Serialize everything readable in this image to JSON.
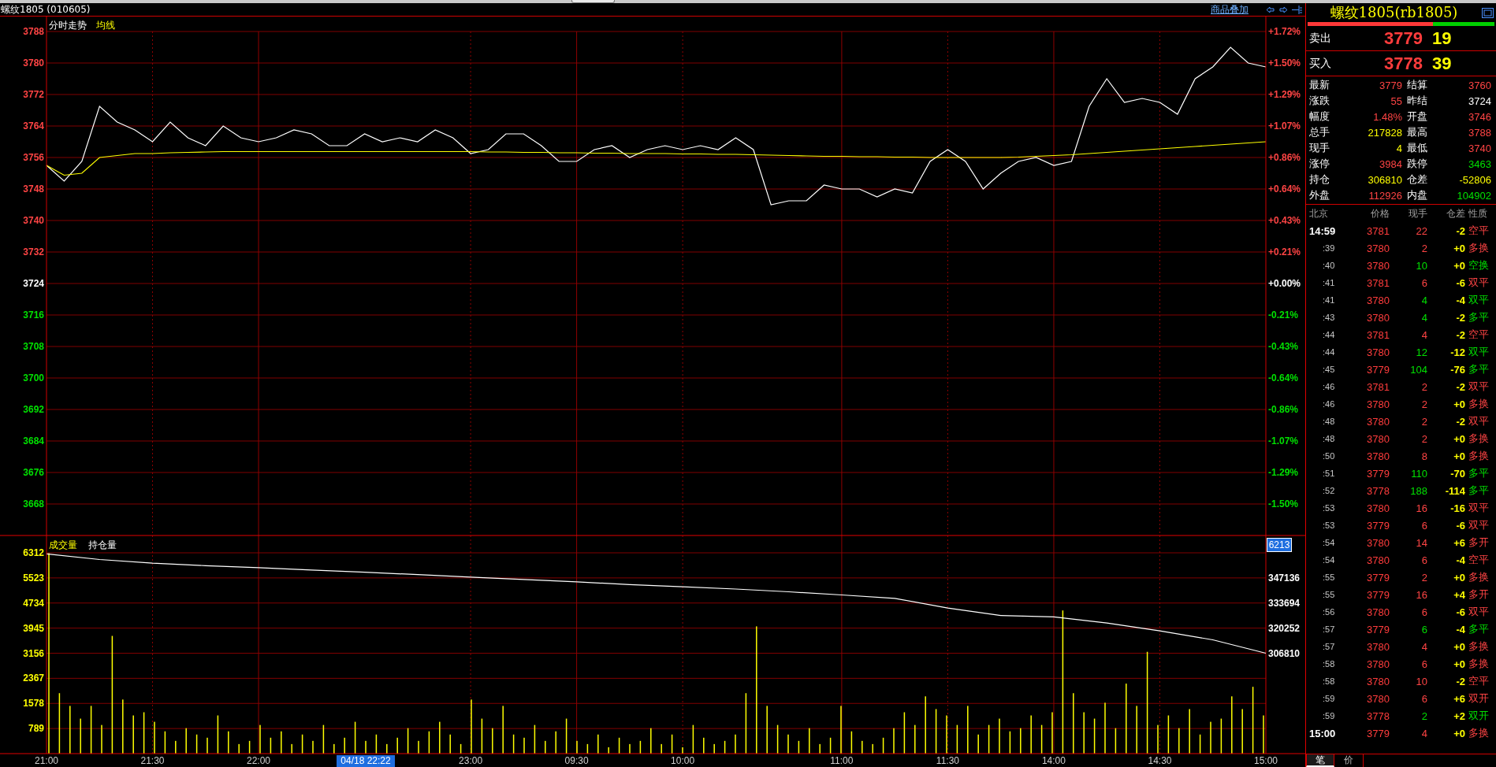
{
  "title_bar": {
    "title": "螺纹1805 (010605)",
    "overlay_link": "商品叠加"
  },
  "price_panel": {
    "chart_data": {
      "type": "line",
      "grid": true,
      "ylim": [
        3660,
        3788
      ],
      "yticks": [
        3788,
        3780,
        3772,
        3764,
        3756,
        3748,
        3740,
        3732,
        3724,
        3716,
        3708,
        3700,
        3692,
        3684,
        3676,
        3668
      ],
      "categories": [
        null,
        null,
        null,
        null,
        null,
        null,
        null,
        null,
        null,
        null,
        null,
        null,
        null,
        null,
        null,
        null,
        null,
        null,
        null,
        null,
        null,
        null,
        null,
        null,
        null,
        null,
        null,
        null,
        null,
        null,
        null,
        null,
        null,
        null,
        null,
        null,
        null,
        null,
        null,
        null,
        null,
        null,
        null,
        null,
        null,
        null,
        null,
        null,
        null,
        null,
        null,
        null,
        null,
        null,
        null,
        null,
        null,
        null,
        null,
        null,
        null,
        null,
        null,
        null,
        null,
        null,
        null,
        null,
        null,
        null
      ],
      "series": [
        {
          "name": "分时走势",
          "color": "#ffffff",
          "values": [
            3754,
            3750,
            3755,
            3769,
            3765,
            3763,
            3760,
            3765,
            3761,
            3759,
            3764,
            3761,
            3760,
            3761,
            3763,
            3762,
            3759,
            3759,
            3762,
            3760,
            3761,
            3760,
            3763,
            3761,
            3757,
            3758,
            3762,
            3762,
            3759,
            3755,
            3755,
            3758,
            3759,
            3756,
            3758,
            3759,
            3758,
            3759,
            3758,
            3761,
            3758,
            3744,
            3745,
            3745,
            3749,
            3748,
            3748,
            3746,
            3748,
            3747,
            3755,
            3758,
            3755,
            3748,
            3752,
            3755,
            3756,
            3754,
            3755,
            3769,
            3776,
            3770,
            3771,
            3770,
            3767,
            3776,
            3779,
            3784,
            3780,
            3779
          ]
        },
        {
          "name": "均线",
          "color": "#ffff00",
          "values": [
            3754,
            3751.5,
            3752,
            3756,
            3756.5,
            3757,
            3757,
            3757.2,
            3757.3,
            3757.4,
            3757.5,
            3757.5,
            3757.5,
            3757.5,
            3757.5,
            3757.5,
            3757.5,
            3757.5,
            3757.5,
            3757.5,
            3757.5,
            3757.5,
            3757.5,
            3757.5,
            3757.5,
            3757.4,
            3757.4,
            3757.3,
            3757.3,
            3757.2,
            3757.2,
            3757.1,
            3757.1,
            3757,
            3757,
            3757,
            3756.9,
            3756.9,
            3756.8,
            3756.8,
            3756.7,
            3756.6,
            3756.5,
            3756.4,
            3756.3,
            3756.3,
            3756.2,
            3756.2,
            3756.1,
            3756.1,
            3756,
            3756,
            3756,
            3756,
            3756,
            3756.1,
            3756.3,
            3756.5,
            3756.7,
            3757,
            3757.3,
            3757.6,
            3757.9,
            3758.2,
            3758.5,
            3758.8,
            3759.1,
            3759.4,
            3759.7,
            3760
          ]
        }
      ]
    },
    "percent_axis": [
      {
        "label": "+1.72%",
        "color": "#ff4444"
      },
      {
        "label": "+1.50%",
        "color": "#ff4444"
      },
      {
        "label": "+1.29%",
        "color": "#ff4444"
      },
      {
        "label": "+1.07%",
        "color": "#ff4444"
      },
      {
        "label": "+0.86%",
        "color": "#ff4444"
      },
      {
        "label": "+0.64%",
        "color": "#ff4444"
      },
      {
        "label": "+0.43%",
        "color": "#ff4444"
      },
      {
        "label": "+0.21%",
        "color": "#ff4444"
      },
      {
        "label": "+0.00%",
        "color": "#ffffff"
      },
      {
        "label": "-0.21%",
        "color": "#00e000"
      },
      {
        "label": "-0.43%",
        "color": "#00e000"
      },
      {
        "label": "-0.64%",
        "color": "#00e000"
      },
      {
        "label": "-0.86%",
        "color": "#00e000"
      },
      {
        "label": "-1.07%",
        "color": "#00e000"
      },
      {
        "label": "-1.29%",
        "color": "#00e000"
      },
      {
        "label": "-1.50%",
        "color": "#00e000"
      }
    ]
  },
  "volume_panel": {
    "chart_data": {
      "type": "bar",
      "grid": true,
      "ylim": [
        0,
        6312
      ],
      "yticks": [
        6312,
        5523,
        4734,
        3945,
        3156,
        2367,
        1578,
        789
      ],
      "categories": [
        "21:00",
        null,
        null,
        null,
        null,
        null,
        null,
        null,
        null,
        null,
        "21:30",
        null,
        null,
        null,
        null,
        null,
        null,
        null,
        null,
        null,
        "22:00",
        null,
        null,
        null,
        null,
        null,
        null,
        null,
        null,
        null,
        null,
        null,
        null,
        null,
        null,
        null,
        null,
        null,
        null,
        null,
        "23:00",
        null,
        null,
        null,
        null,
        null,
        null,
        null,
        null,
        null,
        "09:30",
        null,
        null,
        null,
        null,
        null,
        null,
        null,
        null,
        null,
        "10:00",
        null,
        null,
        null,
        null,
        null,
        null,
        null,
        null,
        null,
        null,
        null,
        null,
        null,
        null,
        "11:00",
        null,
        null,
        null,
        null,
        null,
        null,
        null,
        null,
        null,
        "11:30",
        null,
        null,
        null,
        null,
        null,
        null,
        null,
        null,
        null,
        "14:00",
        null,
        null,
        null,
        null,
        null,
        null,
        null,
        null,
        null,
        "14:30",
        null,
        null,
        null,
        null,
        null,
        null,
        null,
        null,
        null,
        "15:00"
      ],
      "series": [
        {
          "name": "成交量",
          "color": "#ffff00",
          "values": [
            6300,
            1900,
            1500,
            1100,
            1500,
            900,
            3700,
            1700,
            1200,
            1300,
            1000,
            700,
            400,
            800,
            600,
            500,
            1200,
            700,
            300,
            400,
            900,
            500,
            700,
            300,
            600,
            400,
            900,
            300,
            500,
            1000,
            400,
            600,
            300,
            500,
            800,
            400,
            700,
            1000,
            600,
            300,
            1700,
            1100,
            800,
            1500,
            600,
            500,
            900,
            400,
            700,
            1100,
            400,
            300,
            600,
            200,
            500,
            300,
            400,
            800,
            300,
            600,
            200,
            900,
            500,
            300,
            400,
            600,
            1900,
            4000,
            1500,
            900,
            600,
            400,
            800,
            300,
            500,
            1500,
            700,
            400,
            300,
            500,
            800,
            1300,
            900,
            1800,
            1400,
            1200,
            900,
            1500,
            600,
            900,
            1100,
            700,
            800,
            1200,
            900,
            1300,
            4500,
            1900,
            1300,
            1100,
            1600,
            800,
            2200,
            1500,
            3200,
            900,
            1200,
            800,
            1400,
            600,
            1000,
            1100,
            1800,
            1400,
            2100,
            1200
          ]
        }
      ]
    },
    "open_interest": {
      "chart_data": {
        "type": "line",
        "ylim": [
          253042,
          360578
        ],
        "yticks": [
          347136,
          333694,
          320252,
          306810
        ],
        "categories": [
          null,
          null,
          null,
          null,
          null,
          null,
          null,
          null,
          null,
          null,
          null,
          null,
          null,
          null,
          null,
          null,
          null,
          null,
          null,
          null,
          null,
          null,
          null,
          null
        ],
        "series": [
          {
            "name": "持仓量",
            "color": "#ffffff",
            "values": [
              360000,
              357000,
              355000,
              353700,
              352600,
              351400,
              350200,
              348900,
              347600,
              346300,
              345000,
              343600,
              342400,
              341200,
              339700,
              338000,
              336200,
              331000,
              327000,
              326300,
              323000,
              318800,
              314000,
              306810
            ]
          }
        ]
      }
    }
  },
  "cursor": {
    "time_label": "04/18 22:22",
    "volume_label": "6213"
  },
  "quote": {
    "title": "螺纹1805(rb1805)",
    "ratio_bar": {
      "level": 0.67
    },
    "ask": {
      "label": "卖出",
      "price": "3779",
      "volume": "19"
    },
    "bid": {
      "label": "买入",
      "price": "3778",
      "volume": "39"
    },
    "stats": [
      {
        "label": "最新",
        "value": "3779",
        "color": "#ff4444"
      },
      {
        "label": "结算",
        "value": "3760",
        "color": "#ff4444"
      },
      {
        "label": "涨跌",
        "value": "55",
        "color": "#ff4444"
      },
      {
        "label": "昨结",
        "value": "3724",
        "color": "#ffffff"
      },
      {
        "label": "幅度",
        "value": "1.48%",
        "color": "#ff4444"
      },
      {
        "label": "开盘",
        "value": "3746",
        "color": "#ff4444"
      },
      {
        "label": "总手",
        "value": "217828",
        "color": "#ffff00"
      },
      {
        "label": "最高",
        "value": "3788",
        "color": "#ff4444"
      },
      {
        "label": "现手",
        "value": "4",
        "color": "#ffff00"
      },
      {
        "label": "最低",
        "value": "3740",
        "color": "#ff4444"
      },
      {
        "label": "涨停",
        "value": "3984",
        "color": "#ff4444"
      },
      {
        "label": "跌停",
        "value": "3463",
        "color": "#00e000"
      },
      {
        "label": "持仓",
        "value": "306810",
        "color": "#ffff00"
      },
      {
        "label": "仓差",
        "value": "-52806",
        "color": "#ffff00"
      },
      {
        "label": "外盘",
        "value": "112926",
        "color": "#ff4444"
      },
      {
        "label": "内盘",
        "value": "104902",
        "color": "#00e000"
      }
    ]
  },
  "ticks": {
    "columns": [
      "北京",
      "价格",
      "现手",
      "仓差",
      "性质"
    ],
    "rows": [
      {
        "kind": "minute",
        "time": "14:59",
        "price": "3781",
        "volume": "22",
        "oi_change": "-2",
        "nature": "空平",
        "color": "#ff4444"
      },
      {
        "kind": "tick",
        "time": ":39",
        "price": "3780",
        "volume": "2",
        "oi_change": "+0",
        "nature": "多换",
        "color": "#ff4444"
      },
      {
        "kind": "tick",
        "time": ":40",
        "price": "3780",
        "volume": "10",
        "oi_change": "+0",
        "nature": "空换",
        "color": "#00e000"
      },
      {
        "kind": "tick",
        "time": ":41",
        "price": "3781",
        "volume": "6",
        "oi_change": "-6",
        "nature": "双平",
        "color": "#ff4444"
      },
      {
        "kind": "tick",
        "time": ":41",
        "price": "3780",
        "volume": "4",
        "oi_change": "-4",
        "nature": "双平",
        "color": "#00e000"
      },
      {
        "kind": "tick",
        "time": ":43",
        "price": "3780",
        "volume": "4",
        "oi_change": "-2",
        "nature": "多平",
        "color": "#00e000"
      },
      {
        "kind": "tick",
        "time": ":44",
        "price": "3781",
        "volume": "4",
        "oi_change": "-2",
        "nature": "空平",
        "color": "#ff4444"
      },
      {
        "kind": "tick",
        "time": ":44",
        "price": "3780",
        "volume": "12",
        "oi_change": "-12",
        "nature": "双平",
        "color": "#00e000"
      },
      {
        "kind": "tick",
        "time": ":45",
        "price": "3779",
        "volume": "104",
        "oi_change": "-76",
        "nature": "多平",
        "color": "#00e000"
      },
      {
        "kind": "tick",
        "time": ":46",
        "price": "3781",
        "volume": "2",
        "oi_change": "-2",
        "nature": "双平",
        "color": "#ff4444"
      },
      {
        "kind": "tick",
        "time": ":46",
        "price": "3780",
        "volume": "2",
        "oi_change": "+0",
        "nature": "多换",
        "color": "#ff4444"
      },
      {
        "kind": "tick",
        "time": ":48",
        "price": "3780",
        "volume": "2",
        "oi_change": "-2",
        "nature": "双平",
        "color": "#ff4444"
      },
      {
        "kind": "tick",
        "time": ":48",
        "price": "3780",
        "volume": "2",
        "oi_change": "+0",
        "nature": "多换",
        "color": "#ff4444"
      },
      {
        "kind": "tick",
        "time": ":50",
        "price": "3780",
        "volume": "8",
        "oi_change": "+0",
        "nature": "多换",
        "color": "#ff4444"
      },
      {
        "kind": "tick",
        "time": ":51",
        "price": "3779",
        "volume": "110",
        "oi_change": "-70",
        "nature": "多平",
        "color": "#00e000"
      },
      {
        "kind": "tick",
        "time": ":52",
        "price": "3778",
        "volume": "188",
        "oi_change": "-114",
        "nature": "多平",
        "color": "#00e000"
      },
      {
        "kind": "tick",
        "time": ":53",
        "price": "3780",
        "volume": "16",
        "oi_change": "-16",
        "nature": "双平",
        "color": "#ff4444"
      },
      {
        "kind": "tick",
        "time": ":53",
        "price": "3779",
        "volume": "6",
        "oi_change": "-6",
        "nature": "双平",
        "color": "#ff4444"
      },
      {
        "kind": "tick",
        "time": ":54",
        "price": "3780",
        "volume": "14",
        "oi_change": "+6",
        "nature": "多开",
        "color": "#ff4444"
      },
      {
        "kind": "tick",
        "time": ":54",
        "price": "3780",
        "volume": "6",
        "oi_change": "-4",
        "nature": "空平",
        "color": "#ff4444"
      },
      {
        "kind": "tick",
        "time": ":55",
        "price": "3779",
        "volume": "2",
        "oi_change": "+0",
        "nature": "多换",
        "color": "#ff4444"
      },
      {
        "kind": "tick",
        "time": ":55",
        "price": "3779",
        "volume": "16",
        "oi_change": "+4",
        "nature": "多开",
        "color": "#ff4444"
      },
      {
        "kind": "tick",
        "time": ":56",
        "price": "3780",
        "volume": "6",
        "oi_change": "-6",
        "nature": "双平",
        "color": "#ff4444"
      },
      {
        "kind": "tick",
        "time": ":57",
        "price": "3779",
        "volume": "6",
        "oi_change": "-4",
        "nature": "多平",
        "color": "#00e000"
      },
      {
        "kind": "tick",
        "time": ":57",
        "price": "3780",
        "volume": "4",
        "oi_change": "+0",
        "nature": "多换",
        "color": "#ff4444"
      },
      {
        "kind": "tick",
        "time": ":58",
        "price": "3780",
        "volume": "6",
        "oi_change": "+0",
        "nature": "多换",
        "color": "#ff4444"
      },
      {
        "kind": "tick",
        "time": ":58",
        "price": "3780",
        "volume": "10",
        "oi_change": "-2",
        "nature": "空平",
        "color": "#ff4444"
      },
      {
        "kind": "tick",
        "time": ":59",
        "price": "3780",
        "volume": "6",
        "oi_change": "+6",
        "nature": "双开",
        "color": "#ff4444"
      },
      {
        "kind": "tick",
        "time": ":59",
        "price": "3778",
        "volume": "2",
        "oi_change": "+2",
        "nature": "双开",
        "color": "#00e000"
      },
      {
        "kind": "minute",
        "time": "15:00",
        "price": "3779",
        "volume": "4",
        "oi_change": "+0",
        "nature": "多换",
        "color": "#ff4444"
      }
    ]
  },
  "bottom_tabs": [
    {
      "label": "笔",
      "selected": true
    },
    {
      "label": "价",
      "selected": false
    }
  ]
}
